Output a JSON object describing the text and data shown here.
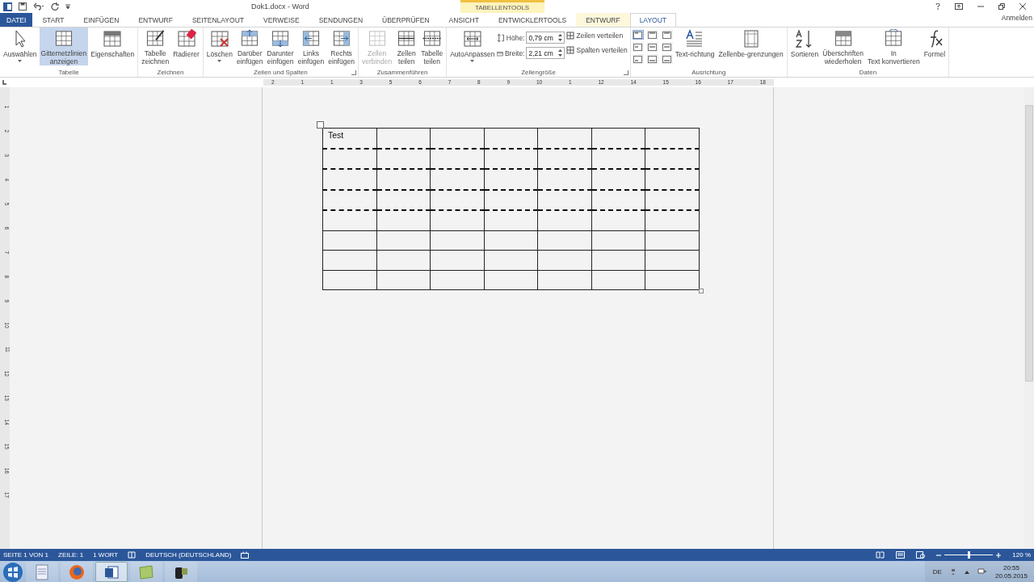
{
  "window": {
    "title": "Dok1.docx - Word",
    "context_group": "TABELLENTOOLS",
    "sign_in": "Anmelden"
  },
  "tabs": [
    {
      "label": "DATEI",
      "kind": "file",
      "selected": false
    },
    {
      "label": "START",
      "kind": "normal",
      "selected": false
    },
    {
      "label": "EINFÜGEN",
      "kind": "normal",
      "selected": false
    },
    {
      "label": "ENTWURF",
      "kind": "normal",
      "selected": false
    },
    {
      "label": "SEITENLAYOUT",
      "kind": "normal",
      "selected": false
    },
    {
      "label": "VERWEISE",
      "kind": "normal",
      "selected": false
    },
    {
      "label": "SENDUNGEN",
      "kind": "normal",
      "selected": false
    },
    {
      "label": "ÜBERPRÜFEN",
      "kind": "normal",
      "selected": false
    },
    {
      "label": "ANSICHT",
      "kind": "normal",
      "selected": false
    },
    {
      "label": "ENTWICKLERTOOLS",
      "kind": "normal",
      "selected": false
    },
    {
      "label": "ENTWURF",
      "kind": "context",
      "selected": false
    },
    {
      "label": "LAYOUT",
      "kind": "context",
      "selected": true
    }
  ],
  "ribbon": [
    {
      "label": "Tabelle",
      "items": [
        {
          "kind": "large",
          "label": "Auswählen",
          "dropdown": true,
          "selected": false,
          "disabled": false
        },
        {
          "kind": "large",
          "label": "Gitternetzlinien anzeigen",
          "dropdown": false,
          "selected": true,
          "disabled": false
        },
        {
          "kind": "large",
          "label": "Eigenschaften",
          "dropdown": false,
          "selected": false,
          "disabled": false
        }
      ]
    },
    {
      "label": "Zeichnen",
      "items": [
        {
          "kind": "large",
          "label": "Tabelle zeichnen",
          "dropdown": false,
          "selected": false,
          "disabled": false
        },
        {
          "kind": "large",
          "label": "Radierer",
          "dropdown": false,
          "selected": false,
          "disabled": false
        }
      ]
    },
    {
      "label": "Zeilen und Spalten",
      "launcher": true,
      "items": [
        {
          "kind": "large",
          "label": "Löschen",
          "dropdown": true,
          "selected": false,
          "disabled": false
        },
        {
          "kind": "large",
          "label": "Darüber einfügen",
          "dropdown": false,
          "selected": false,
          "disabled": false
        },
        {
          "kind": "large",
          "label": "Darunter einfügen",
          "dropdown": false,
          "selected": false,
          "disabled": false
        },
        {
          "kind": "large",
          "label": "Links einfügen",
          "dropdown": false,
          "selected": false,
          "disabled": false
        },
        {
          "kind": "large",
          "label": "Rechts einfügen",
          "dropdown": false,
          "selected": false,
          "disabled": false
        }
      ]
    },
    {
      "label": "Zusammenführen",
      "items": [
        {
          "kind": "large",
          "label": "Zellen verbinden",
          "dropdown": false,
          "selected": false,
          "disabled": true
        },
        {
          "kind": "large",
          "label": "Zellen teilen",
          "dropdown": false,
          "selected": false,
          "disabled": false
        },
        {
          "kind": "large",
          "label": "Tabelle teilen",
          "dropdown": false,
          "selected": false,
          "disabled": false
        }
      ]
    },
    {
      "label": "Zellengröße",
      "launcher": true,
      "items": [
        {
          "kind": "large",
          "label": "AutoAnpassen",
          "dropdown": true,
          "selected": false,
          "disabled": false
        },
        {
          "kind": "spins",
          "fields": [
            {
              "label": "Höhe:",
              "value": "0,79 cm"
            },
            {
              "label": "Breite:",
              "value": "2,21 cm"
            }
          ]
        },
        {
          "kind": "smalls",
          "buttons": [
            "Zeilen verteilen",
            "Spalten verteilen"
          ]
        }
      ]
    },
    {
      "label": "Ausrichtung",
      "items": [
        {
          "kind": "aligngrid",
          "cells": [
            {
              "selected": true
            },
            {
              "selected": false
            },
            {
              "selected": false
            },
            {
              "selected": false
            },
            {
              "selected": false
            },
            {
              "selected": false
            },
            {
              "selected": false
            },
            {
              "selected": false
            },
            {
              "selected": false
            }
          ]
        },
        {
          "kind": "large",
          "label": "Text-richtung",
          "dropdown": false,
          "selected": false,
          "disabled": false
        },
        {
          "kind": "large",
          "label": "Zellenbe-grenzungen",
          "dropdown": false,
          "selected": false,
          "disabled": false
        }
      ]
    },
    {
      "label": "Daten",
      "items": [
        {
          "kind": "large",
          "label": "Sortieren",
          "dropdown": false,
          "selected": false,
          "disabled": false
        },
        {
          "kind": "large",
          "label": "Überschriften wiederholen",
          "dropdown": false,
          "selected": false,
          "disabled": false
        },
        {
          "kind": "large",
          "label": "In Text konvertieren",
          "dropdown": false,
          "selected": false,
          "disabled": false
        },
        {
          "kind": "large",
          "label": "Formel",
          "dropdown": false,
          "selected": false,
          "disabled": false
        }
      ]
    }
  ],
  "ruler": {
    "numbers": [
      "2",
      "1",
      "1",
      "3",
      "5",
      "6",
      "7",
      "8",
      "9",
      "10",
      "1",
      "12",
      "14",
      "15",
      "16",
      "17",
      "18"
    ],
    "vertical_numbers": [
      "1",
      "2",
      "3",
      "4",
      "5",
      "6",
      "7",
      "8",
      "9",
      "10",
      "11",
      "12",
      "13",
      "14",
      "15",
      "16",
      "17"
    ]
  },
  "table": {
    "rows": [
      {
        "gridline_below": true,
        "cells": [
          {
            "text": "Test"
          },
          {},
          {},
          {},
          {},
          {},
          {}
        ]
      },
      {
        "gridline_below": true,
        "cells": [
          {},
          {},
          {},
          {},
          {},
          {},
          {}
        ]
      },
      {
        "gridline_below": true,
        "cells": [
          {},
          {},
          {},
          {},
          {},
          {},
          {}
        ]
      },
      {
        "gridline_below": true,
        "cells": [
          {},
          {},
          {},
          {},
          {},
          {},
          {}
        ]
      },
      {
        "gridline_below": false,
        "cells": [
          {},
          {},
          {},
          {},
          {},
          {},
          {}
        ]
      },
      {
        "gridline_below": false,
        "cells": [
          {},
          {},
          {},
          {},
          {},
          {},
          {}
        ]
      },
      {
        "gridline_below": false,
        "cells": [
          {},
          {},
          {},
          {},
          {},
          {},
          {}
        ]
      },
      {
        "gridline_below": false,
        "cells": [
          {},
          {},
          {},
          {},
          {},
          {},
          {}
        ]
      }
    ]
  },
  "status_bar": {
    "items": [
      "SEITE 1 VON 1",
      "ZEILE: 1",
      "1 WORT"
    ],
    "language": "DEUTSCH (DEUTSCHLAND)",
    "zoom": {
      "level": 0.47,
      "label": "120 %"
    }
  },
  "taskbar": {
    "apps": [
      {
        "kind": "notepad",
        "selected": false
      },
      {
        "kind": "firefox",
        "selected": false
      },
      {
        "kind": "word",
        "selected": true
      },
      {
        "kind": "notes",
        "selected": false
      },
      {
        "kind": "camera",
        "selected": false
      }
    ],
    "language": "DE",
    "time": "20:55",
    "date": "20.05.2015"
  }
}
